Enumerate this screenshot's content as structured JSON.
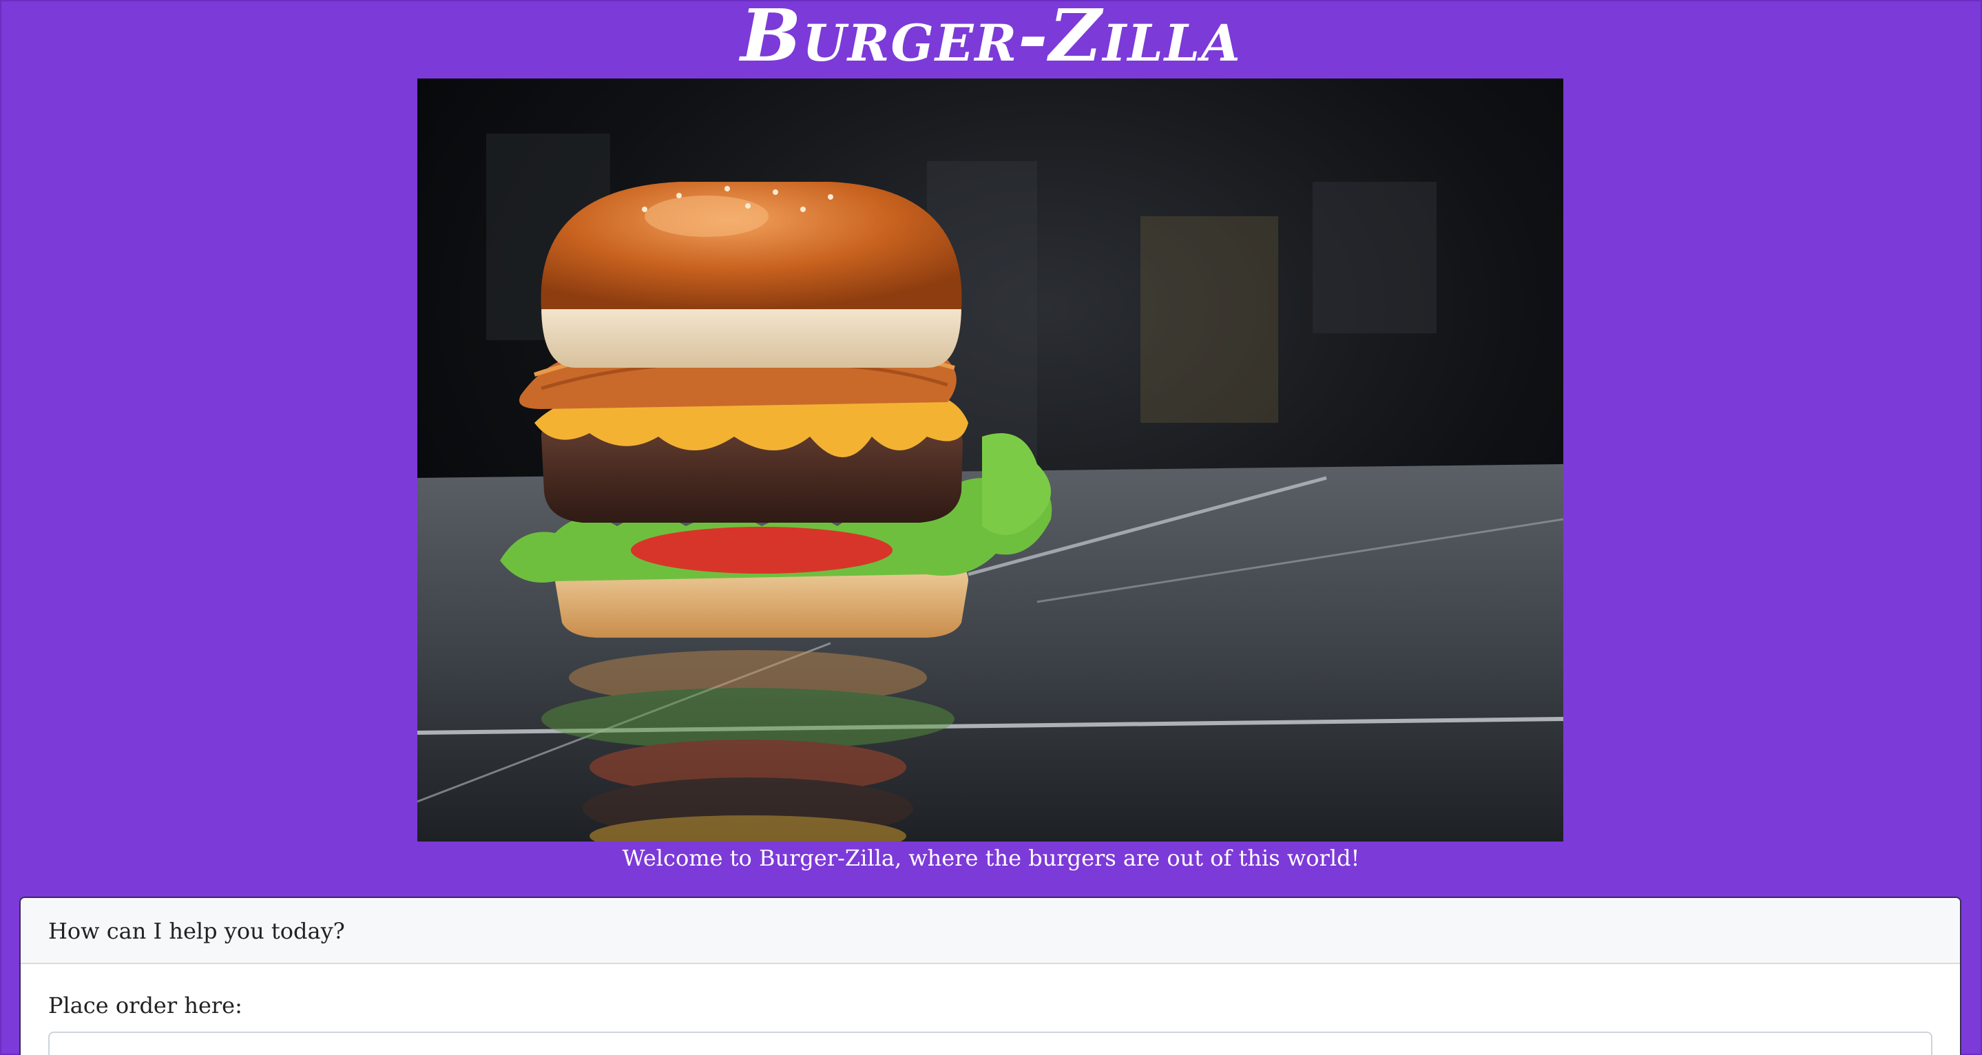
{
  "header": {
    "title": "Burger-Zilla"
  },
  "hero": {
    "image_icon": "burger-photo"
  },
  "welcome_text": "Welcome to Burger-Zilla, where the burgers are out of this world!",
  "chat_card": {
    "header": "How can I help you today?",
    "order_label": "Place order here:",
    "order_input_value": "",
    "order_input_placeholder": ""
  },
  "colors": {
    "background": "#7c3ad9",
    "card_header_bg": "#f7f8f9",
    "text_light": "#ffffff",
    "text_dark": "#222222"
  }
}
